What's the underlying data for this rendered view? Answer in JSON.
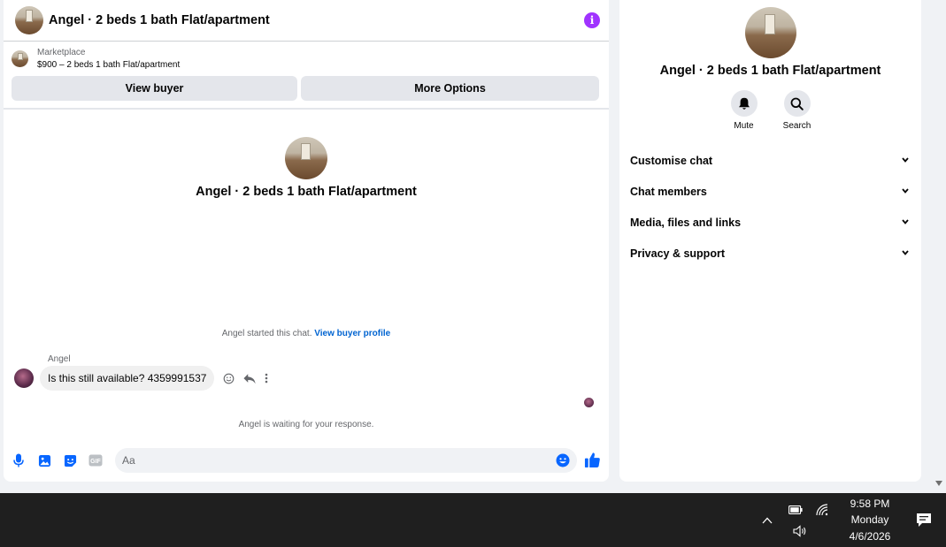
{
  "chat": {
    "title": "Angel · 2 beds 1 bath Flat/apartment",
    "listing": {
      "label": "Marketplace",
      "price_line": "$900 – 2 beds 1 bath Flat/apartment",
      "view_buyer_label": "View buyer",
      "more_options_label": "More Options"
    },
    "intro_title": "Angel · 2 beds 1 bath Flat/apartment",
    "started_text": "Angel started this chat.",
    "view_profile_link": "View buyer profile",
    "sender_name": "Angel",
    "message": "Is this still available? 4359991537",
    "waiting_text": "Angel is waiting for your response.",
    "composer_placeholder": "Aa",
    "gif_label": "GIF"
  },
  "info": {
    "title": "Angel · 2 beds 1 bath Flat/apartment",
    "mute_label": "Mute",
    "search_label": "Search",
    "sections": [
      {
        "label": "Customise chat"
      },
      {
        "label": "Chat members"
      },
      {
        "label": "Media, files and links"
      },
      {
        "label": "Privacy & support"
      }
    ]
  },
  "taskbar": {
    "time": "9:58 PM",
    "day": "Monday",
    "date": "4/6/2026"
  },
  "colors": {
    "accent_blue": "#0866ff",
    "info_purple": "#a033ff",
    "taskbar_bg": "#1f1f1f"
  },
  "icons": [
    "info-icon",
    "microphone-icon",
    "image-icon",
    "sticker-icon",
    "gif-icon",
    "emoji-icon",
    "like-icon",
    "react-icon",
    "reply-icon",
    "more-icon",
    "bell-icon",
    "search-icon",
    "chevron-down-icon",
    "chevron-up-icon",
    "battery-icon",
    "wifi-icon",
    "volume-icon",
    "notification-icon"
  ]
}
